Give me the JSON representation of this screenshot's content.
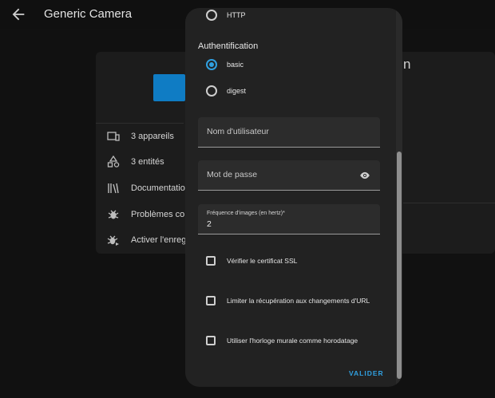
{
  "header": {
    "title": "Generic Camera"
  },
  "background_card": {
    "clipped_text": "n",
    "rows": [
      {
        "label": "3 appareils",
        "icon": "devices-icon"
      },
      {
        "label": "3 entités",
        "icon": "shapes-icon"
      },
      {
        "label": "Documentation",
        "icon": "book-icon"
      },
      {
        "label": "Problèmes conn",
        "icon": "bug-icon"
      },
      {
        "label": "Activer l'enregist",
        "icon": "bug-play-icon"
      }
    ],
    "colors": {
      "logo": "#0f7cc4"
    }
  },
  "dialog": {
    "protocol_option": "HTTP",
    "auth_title": "Authentification",
    "auth_options": [
      {
        "label": "basic",
        "selected": true
      },
      {
        "label": "digest",
        "selected": false
      }
    ],
    "username": {
      "placeholder": "Nom d'utilisateur"
    },
    "password": {
      "placeholder": "Mot de passe"
    },
    "framerate": {
      "label": "Fréquence d'images (en hertz)*",
      "value": "2"
    },
    "checkboxes": [
      {
        "label": "Vérifier le certificat SSL",
        "checked": false
      },
      {
        "label": "Limiter la récupération aux changements d'URL",
        "checked": false
      },
      {
        "label": "Utiliser l'horloge murale comme horodatage",
        "checked": false
      }
    ],
    "submit_label": "VALIDER",
    "colors": {
      "accent": "#30a0e0",
      "surface": "#222222"
    }
  }
}
